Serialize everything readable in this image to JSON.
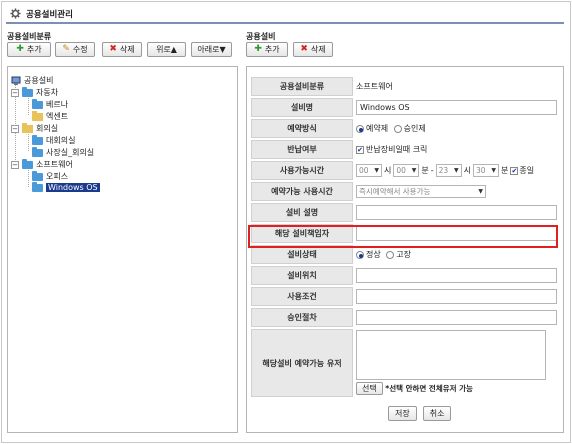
{
  "window": {
    "title": "공용설비관리"
  },
  "left": {
    "section_label": "공용설비분류",
    "buttons": {
      "add": "추가",
      "edit": "수정",
      "delete": "삭제",
      "up": "위로▲",
      "down": "아래로▼"
    },
    "tree": [
      {
        "label": "공용설비"
      },
      {
        "label": "자동차"
      },
      {
        "label": "베르나"
      },
      {
        "label": "엑센트"
      },
      {
        "label": "회의실"
      },
      {
        "label": "대회의실"
      },
      {
        "label": "사장실_회의실"
      },
      {
        "label": "소프트웨어"
      },
      {
        "label": "오피스"
      },
      {
        "label": "Windows OS"
      }
    ]
  },
  "right": {
    "section_label": "공용설비",
    "buttons": {
      "add": "추가",
      "delete": "삭제"
    },
    "form": {
      "category_label": "공용설비분류",
      "category_value": "소프트웨어",
      "name_label": "설비명",
      "name_value": "Windows OS",
      "booking_label": "예약방식",
      "booking_opt1": "예약제",
      "booking_opt2": "승인제",
      "return_label": "반납여부",
      "return_opt": "반납장비일때 크릭",
      "time_label": "사용가능시간",
      "time_h1": "00",
      "time_h_unit": "시",
      "time_m1": "00",
      "time_m_unit": "분",
      "time_sep": "-",
      "time_h2": "23",
      "time_m2": "30",
      "time_allday": "종일",
      "avail_label": "예약가능 사용시간",
      "avail_value": "즉시예약해서 사용가능",
      "desc_label": "설비 설명",
      "manager_label": "해당 설비책임자",
      "status_label": "설비상태",
      "status_opt1": "정상",
      "status_opt2": "고장",
      "location_label": "설비위치",
      "conditions_label": "사용조건",
      "approval_label": "승인절차",
      "users_label": "해당설비 예약가능 유저",
      "select_btn": "선택",
      "select_note": "*선택 안하면 전체유저 가능"
    },
    "save": "저장",
    "cancel": "취소"
  },
  "colors": {
    "accent": "#1a3a8e",
    "highlight": "#e02020",
    "title_rule": "#7d8fb3"
  }
}
